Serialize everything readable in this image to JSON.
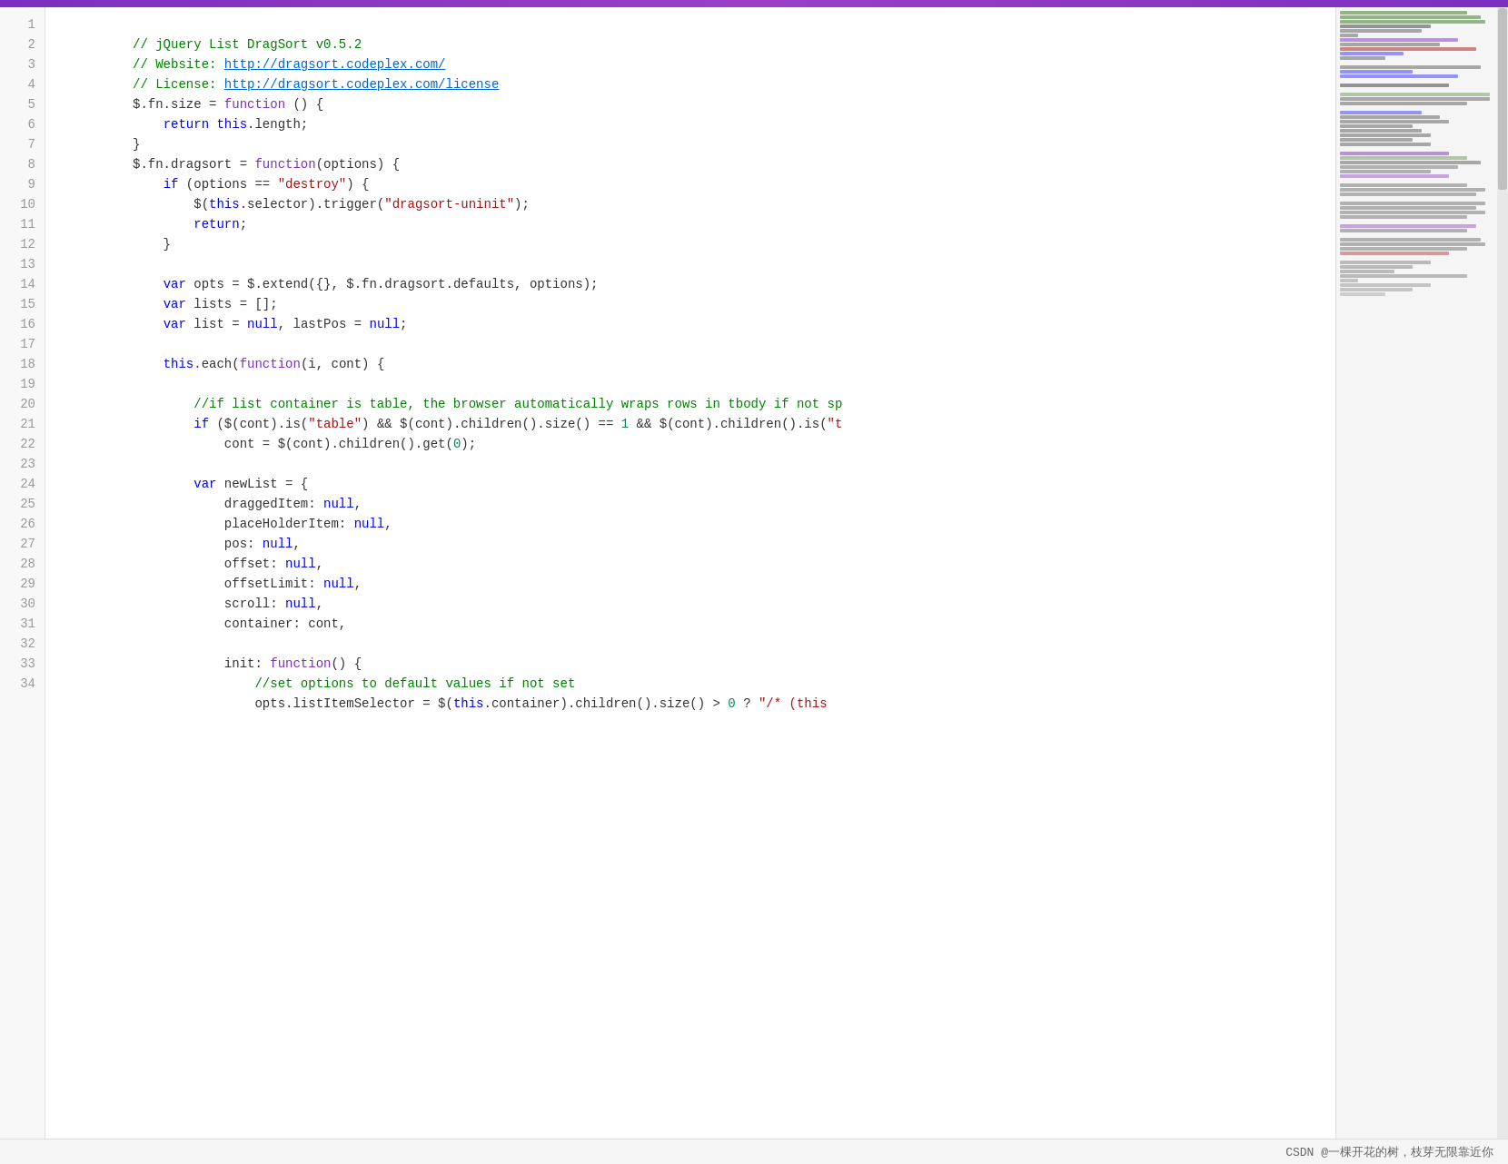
{
  "topbar": {
    "color": "#7b2fbe"
  },
  "code": {
    "lines": [
      {
        "num": 1,
        "content": "comment_jquery_dragsort",
        "raw": "// jQuery List DragSort v0.5.2"
      },
      {
        "num": 2,
        "content": "comment_website",
        "raw": "// Website: http://dragsort.codeplex.com/"
      },
      {
        "num": 3,
        "content": "comment_license",
        "raw": "// License: http://dragsort.codeplex.com/license"
      },
      {
        "num": 4,
        "content": "fn_size",
        "raw": "$.fn.size = function () {"
      },
      {
        "num": 5,
        "content": "return_length",
        "raw": "    return this.length;"
      },
      {
        "num": 6,
        "content": "close_brace_1",
        "raw": "}"
      },
      {
        "num": 7,
        "content": "fn_dragsort",
        "raw": "$.fn.dragsort = function(options) {"
      },
      {
        "num": 8,
        "content": "if_options",
        "raw": "    if (options == \"destroy\") {"
      },
      {
        "num": 9,
        "content": "trigger",
        "raw": "        $(this.selector).trigger(\"dragsort-uninit\");"
      },
      {
        "num": 10,
        "content": "return_stmt",
        "raw": "        return;"
      },
      {
        "num": 11,
        "content": "close_brace_2",
        "raw": "    }"
      },
      {
        "num": 12,
        "content": "empty_12",
        "raw": ""
      },
      {
        "num": 13,
        "content": "var_opts",
        "raw": "    var opts = $.extend({}, $.fn.dragsort.defaults, options);"
      },
      {
        "num": 14,
        "content": "var_lists",
        "raw": "    var lists = [];"
      },
      {
        "num": 15,
        "content": "var_list",
        "raw": "    var list = null, lastPos = null;"
      },
      {
        "num": 16,
        "content": "empty_16",
        "raw": ""
      },
      {
        "num": 17,
        "content": "this_each",
        "raw": "    this.each(function(i, cont) {"
      },
      {
        "num": 18,
        "content": "empty_18",
        "raw": ""
      },
      {
        "num": 19,
        "content": "comment_if_list",
        "raw": "        //if list container is table, the browser automatically wraps rows in tbody if not sp"
      },
      {
        "num": 20,
        "content": "if_cont",
        "raw": "        if ($(cont).is(\"table\") && $(cont).children().size() == 1 && $(cont).children().is(\"t"
      },
      {
        "num": 21,
        "content": "cont_assign",
        "raw": "            cont = $(cont).children().get(0);"
      },
      {
        "num": 22,
        "content": "empty_22",
        "raw": ""
      },
      {
        "num": 23,
        "content": "var_newlist",
        "raw": "        var newList = {"
      },
      {
        "num": 24,
        "content": "dragged_item",
        "raw": "            draggedItem: null,"
      },
      {
        "num": 25,
        "content": "placeholder_item",
        "raw": "            placeHolderItem: null,"
      },
      {
        "num": 26,
        "content": "pos",
        "raw": "            pos: null,"
      },
      {
        "num": 27,
        "content": "offset",
        "raw": "            offset: null,"
      },
      {
        "num": 28,
        "content": "offset_limit",
        "raw": "            offsetLimit: null,"
      },
      {
        "num": 29,
        "content": "scroll",
        "raw": "            scroll: null,"
      },
      {
        "num": 30,
        "content": "container",
        "raw": "            container: cont,"
      },
      {
        "num": 31,
        "content": "empty_31",
        "raw": ""
      },
      {
        "num": 32,
        "content": "init_fn",
        "raw": "            init: function() {"
      },
      {
        "num": 33,
        "content": "comment_set_options",
        "raw": "                //set options to default values if not set"
      },
      {
        "num": 34,
        "content": "line_34",
        "raw": "                opts.listItemSelector = $(this.container).children().size() > 0 ? \"/*(this"
      }
    ]
  },
  "bottom_bar": {
    "text": "CSDN @一棵开花的树，枝芽无限靠近你"
  },
  "minimap": {
    "visible_region_color": "#e8e8e8"
  }
}
